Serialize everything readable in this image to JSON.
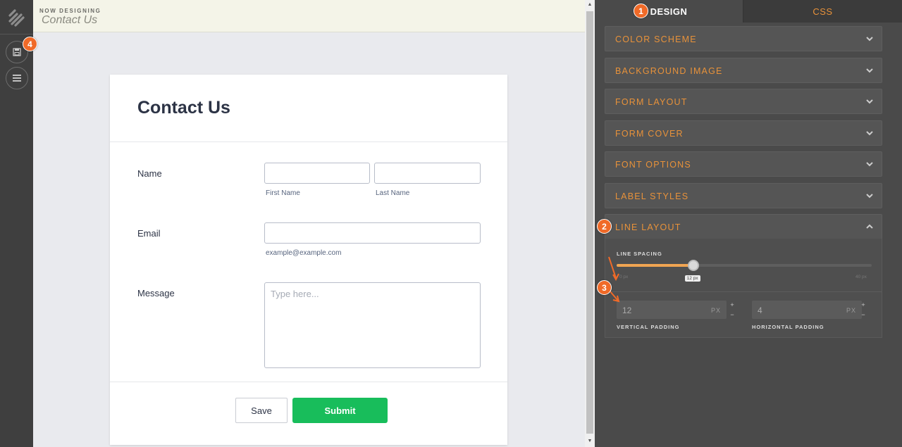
{
  "header": {
    "kicker": "NOW DESIGNING",
    "form_name": "Contact Us"
  },
  "form": {
    "title": "Contact Us",
    "name_label": "Name",
    "first_name_sub": "First Name",
    "last_name_sub": "Last Name",
    "email_label": "Email",
    "email_sub": "example@example.com",
    "message_label": "Message",
    "message_placeholder": "Type here...",
    "save_label": "Save",
    "submit_label": "Submit"
  },
  "panel": {
    "tabs": [
      {
        "label": "DESIGN"
      },
      {
        "label": "CSS"
      }
    ],
    "sections": [
      {
        "label": "COLOR SCHEME"
      },
      {
        "label": "BACKGROUND IMAGE"
      },
      {
        "label": "FORM LAYOUT"
      },
      {
        "label": "FORM COVER"
      },
      {
        "label": "FONT OPTIONS"
      },
      {
        "label": "LABEL STYLES"
      },
      {
        "label": "LINE LAYOUT"
      }
    ],
    "line_layout": {
      "spacing_label": "LINE SPACING",
      "slider_min": "0 px",
      "slider_max": "40 px",
      "slider_value_text": "12 px",
      "slider_value": 12,
      "slider_range": [
        0,
        40
      ],
      "vertical_padding": {
        "value": "12",
        "unit": "PX",
        "label": "VERTICAL PADDING"
      },
      "horizontal_padding": {
        "value": "4",
        "unit": "PX",
        "label": "HORIZONTAL PADDING"
      },
      "step_plus": "+",
      "step_minus": "−"
    }
  },
  "annotations": [
    "1",
    "2",
    "3",
    "4"
  ],
  "colors": {
    "accent": "#e8923a",
    "submit": "#18bd5b",
    "badge": "#f06a28"
  }
}
